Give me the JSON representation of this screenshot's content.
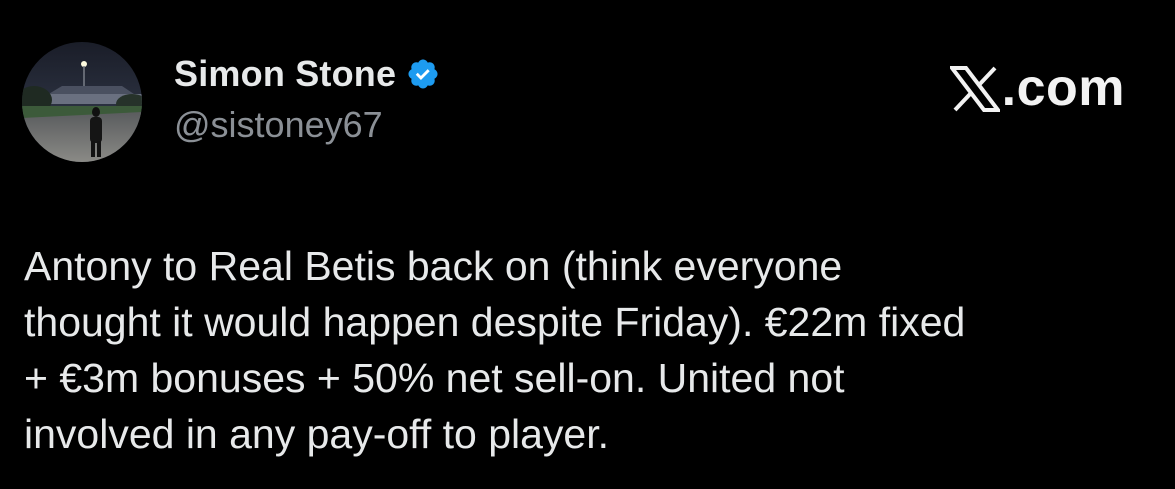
{
  "author": {
    "display_name": "Simon Stone",
    "handle": "@sistoney67",
    "verified": true,
    "avatar_icon": "profile-photo"
  },
  "brand": {
    "text": ".com",
    "logo_icon": "x-logo-icon"
  },
  "tweet": {
    "text": "Antony to Real Betis back on (think everyone\nthought it would happen despite Friday). €22m fixed\n+ €3m bonuses + 50% net sell-on. United not\ninvolved in any pay-off to player."
  },
  "colors": {
    "background": "#000000",
    "text": "#e7e9ea",
    "handle": "#8b9096",
    "verified": "#1d9bf0"
  }
}
